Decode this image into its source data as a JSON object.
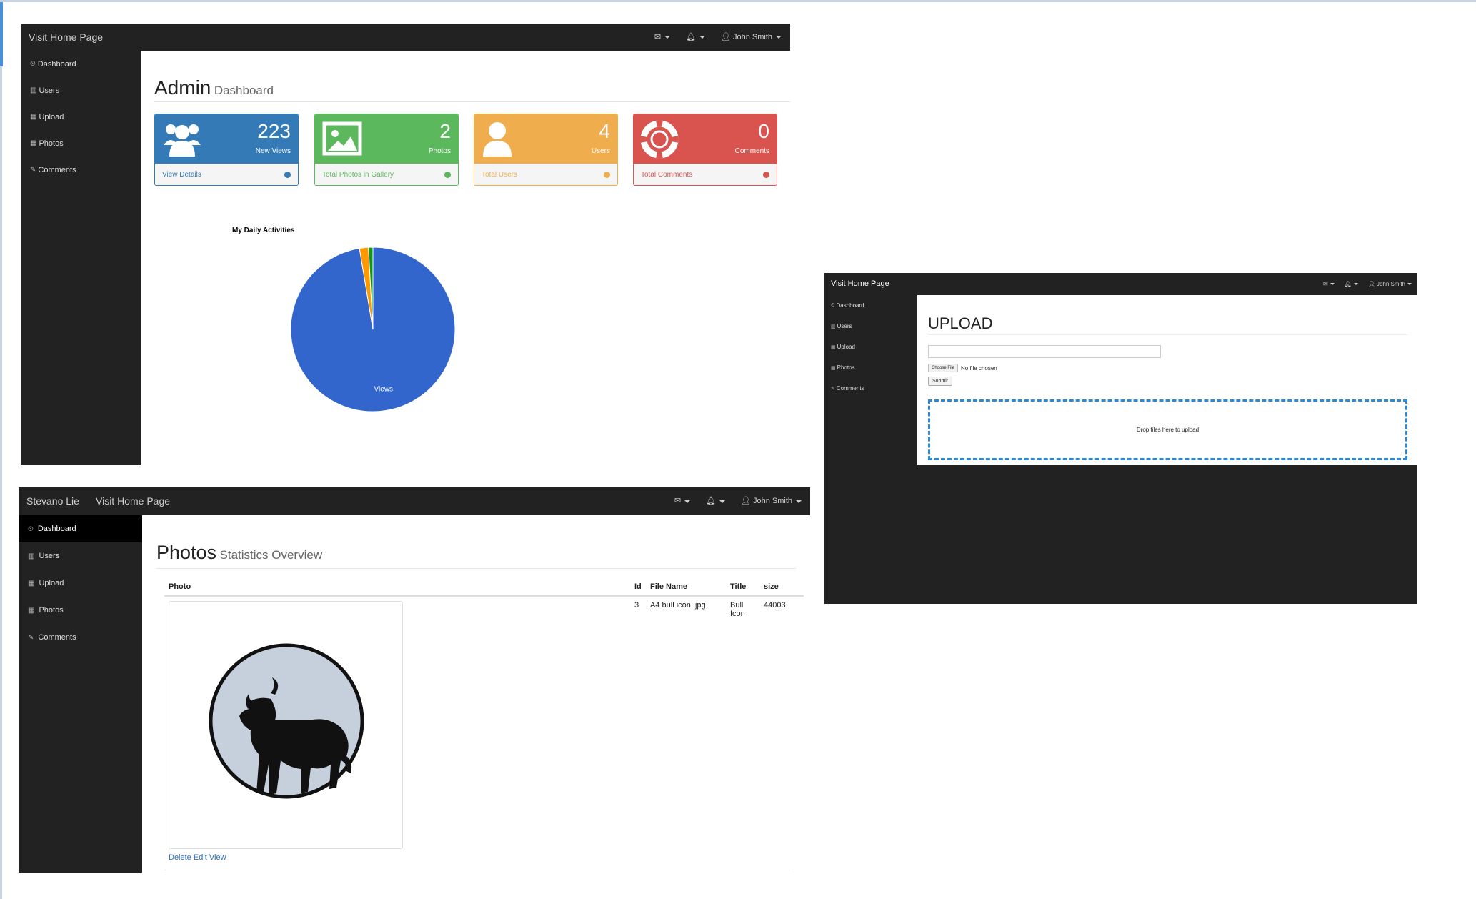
{
  "dashboard": {
    "navbar": {
      "brand": "Visit Home Page",
      "user": "John Smith"
    },
    "sidebar": [
      "Dashboard",
      "Users",
      "Upload",
      "Photos",
      "Comments"
    ],
    "header": {
      "title": "Admin",
      "subtitle": "Dashboard"
    },
    "cards": [
      {
        "number": "223",
        "label": "New Views",
        "footer": "View Details",
        "color": "#337ab7",
        "icon": "users-icon"
      },
      {
        "number": "2",
        "label": "Photos",
        "footer": "Total Photos in Gallery",
        "color": "#5cb85c",
        "icon": "picture-icon"
      },
      {
        "number": "4",
        "label": "Users",
        "footer": "Total Users",
        "color": "#f0ad4e",
        "icon": "user-icon"
      },
      {
        "number": "0",
        "label": "Comments",
        "footer": "Total Comments",
        "color": "#d9534f",
        "icon": "life-ring-icon"
      }
    ]
  },
  "chart_data": {
    "type": "pie",
    "title": "My Daily Activities",
    "slices": [
      {
        "label": "Views",
        "value": 223,
        "color": "#3366cc"
      },
      {
        "label": "",
        "value": 4,
        "color": "#ff9900"
      },
      {
        "label": "",
        "value": 2,
        "color": "#109618"
      },
      {
        "label": "",
        "value": 0,
        "color": "#dc3912"
      }
    ]
  },
  "photos": {
    "navbar": {
      "brand": "Stevano Lie",
      "link": "Visit Home Page",
      "user": "John Smith"
    },
    "sidebar": [
      "Dashboard",
      "Users",
      "Upload",
      "Photos",
      "Comments"
    ],
    "active_sidebar": "Dashboard",
    "header": {
      "title": "Photos",
      "subtitle": "Statistics Overview"
    },
    "columns": [
      "Photo",
      "Id",
      "File Name",
      "Title",
      "size"
    ],
    "rows": [
      {
        "id": "3",
        "file_name": "A4 bull icon .jpg",
        "title": "Bull Icon",
        "size": "44003"
      }
    ],
    "actions": "Delete Edit View"
  },
  "upload": {
    "navbar": {
      "brand": "Visit Home Page",
      "user": "John Smith"
    },
    "sidebar": [
      "Dashboard",
      "Users",
      "Upload",
      "Photos",
      "Comments"
    ],
    "title": "UPLOAD",
    "choose_file": "Choose File",
    "no_file": "No file chosen",
    "submit": "Submit",
    "dropzone": "Drop files here to upload"
  }
}
